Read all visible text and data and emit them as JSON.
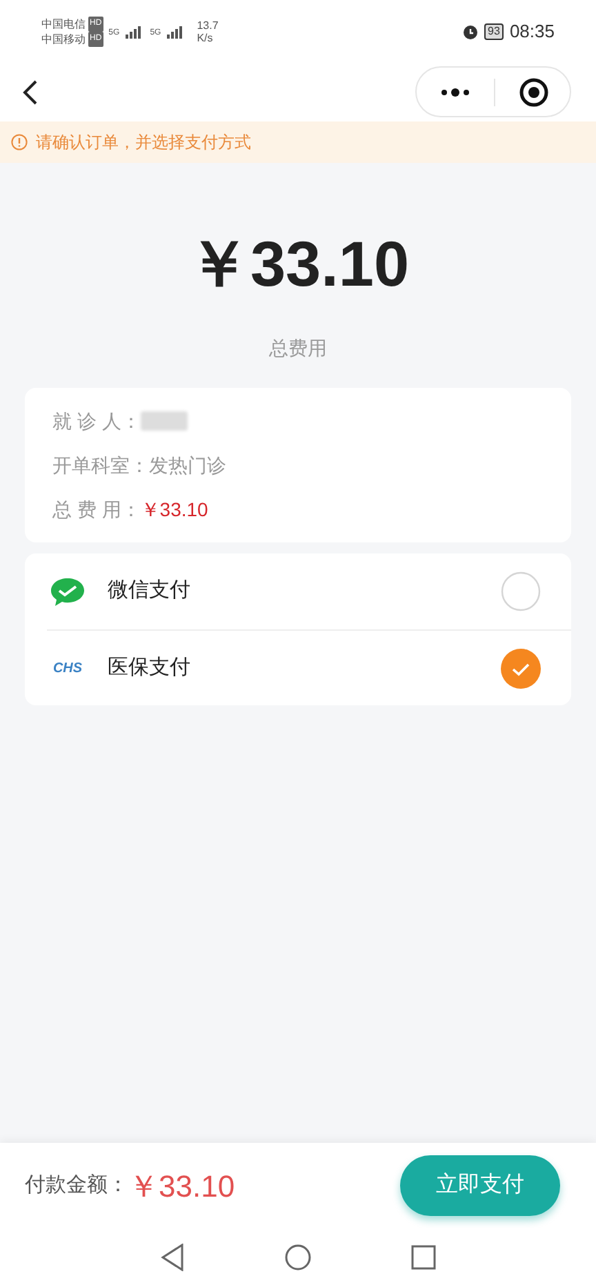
{
  "status_bar": {
    "carrier_1": "中国电信",
    "carrier_2": "中国移动",
    "hd_1": "HD",
    "hd_2": "HD",
    "net_1": "5G",
    "net_2": "5G",
    "speed": "13.7",
    "speed_unit": "K/s",
    "battery": "93",
    "time": "08:35"
  },
  "notice": "请确认订单，并选择支付方式",
  "amount": "￥33.10",
  "amount_label": "总费用",
  "details": [
    {
      "label": "就 诊 人：",
      "kind": "masked"
    },
    {
      "label": "开单科室：",
      "value": "发热门诊",
      "kind": "plain"
    },
    {
      "label": "总 费 用：",
      "value": "￥33.10",
      "kind": "price"
    }
  ],
  "payment_methods": [
    {
      "label": "微信支付",
      "kind": "wechat",
      "selected": false
    },
    {
      "label": "医保支付",
      "kind": "chs",
      "logo": "CHS",
      "selected": true
    }
  ],
  "footer": {
    "label": "付款金额：",
    "amount": "￥33.10",
    "button": "立即支付"
  }
}
